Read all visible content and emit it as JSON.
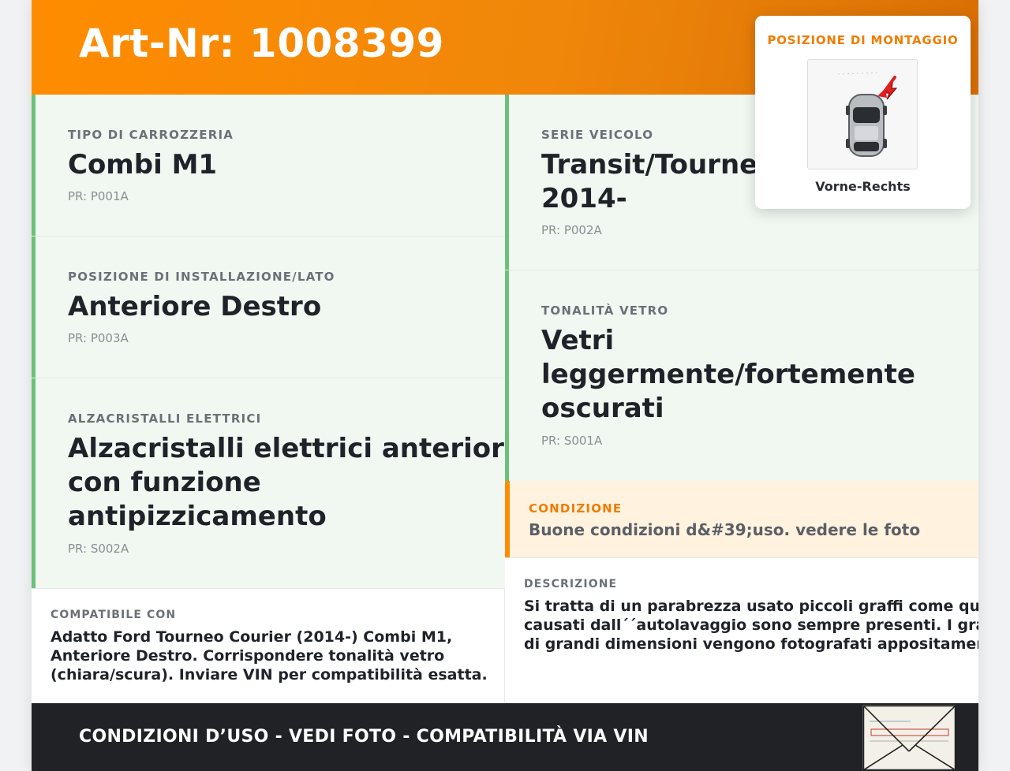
{
  "header": {
    "title": "Art-Nr: 1008399",
    "accent_color": "#ff8c00"
  },
  "fields": {
    "body_type": {
      "label": "TIPO DI CARROZZERIA",
      "value": "Combi M1",
      "code": "PR: P001A"
    },
    "vehicle_series": {
      "label": "SERIE VEICOLO",
      "value_line1": "Transit/Tourneo Courier",
      "value_line2": "2014-",
      "code": "PR: P002A"
    },
    "install_position": {
      "label": "POSIZIONE DI INSTALLAZIONE/LATO",
      "value": "Anteriore Destro",
      "code": "PR: P003A"
    },
    "glass_tint": {
      "label": "TONALITÀ VETRO",
      "value_line1": "Vetri",
      "value_line2": "leggermente/fortemente",
      "value_line3": "oscurati",
      "code": "PR: S001A"
    },
    "power_windows": {
      "label": "ALZACRISTALLI ELETTRICI",
      "value_line1": "Alzacristalli elettrici anteriori",
      "value_line2": "con funzione",
      "value_line3": "antipizzicamento",
      "code": "PR: S002A"
    }
  },
  "condition": {
    "label": "CONDIZIONE",
    "text": "Buone condizioni d&#39;uso. vedere le foto",
    "color": "#ff8c00"
  },
  "compatible": {
    "label": "COMPATIBILE CON",
    "line1": "Adatto Ford Tourneo Courier (2014-) Combi M1,",
    "line2": "Anteriore Destro. Corrispondere tonalità vetro",
    "line3": "(chiara/scura). Inviare VIN per compatibilità esatta."
  },
  "description": {
    "label": "DESCRIZIONE",
    "line1": "Si tratta di un parabrezza usato piccoli graffi come quelli",
    "line2": "causati dall´´autolavaggio sono sempre presenti. I graffi",
    "line3": "di grandi dimensioni vengono fotografati appositamente."
  },
  "mounting": {
    "title": "POSIZIONE DI MONTAGGIO",
    "caption": "Vorne-Rechts",
    "icon": "car-top-view-icon"
  },
  "footer": {
    "text": "CONDIZIONI D’USO - VEDI FOTO - COMPATIBILITÀ VIA VIN",
    "stamp_icon": "envelope-stamp-icon"
  }
}
